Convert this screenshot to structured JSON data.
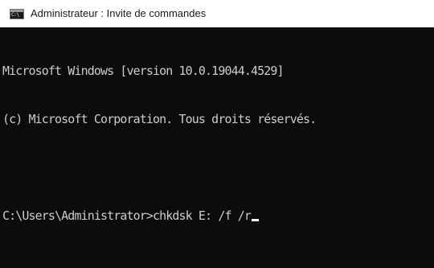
{
  "window": {
    "title": "Administrateur : Invite de commandes",
    "icon": "cmd-icon",
    "colors": {
      "titlebar_bg": "#ffffff",
      "console_bg": "#0c0c0c",
      "console_fg": "#cccccc"
    }
  },
  "console": {
    "lines": [
      "Microsoft Windows [version 10.0.19044.4529]",
      "(c) Microsoft Corporation. Tous droits réservés.",
      "",
      "C:\\Users\\Administrator>chkdsk E: /f /r"
    ],
    "cursor": "_"
  }
}
